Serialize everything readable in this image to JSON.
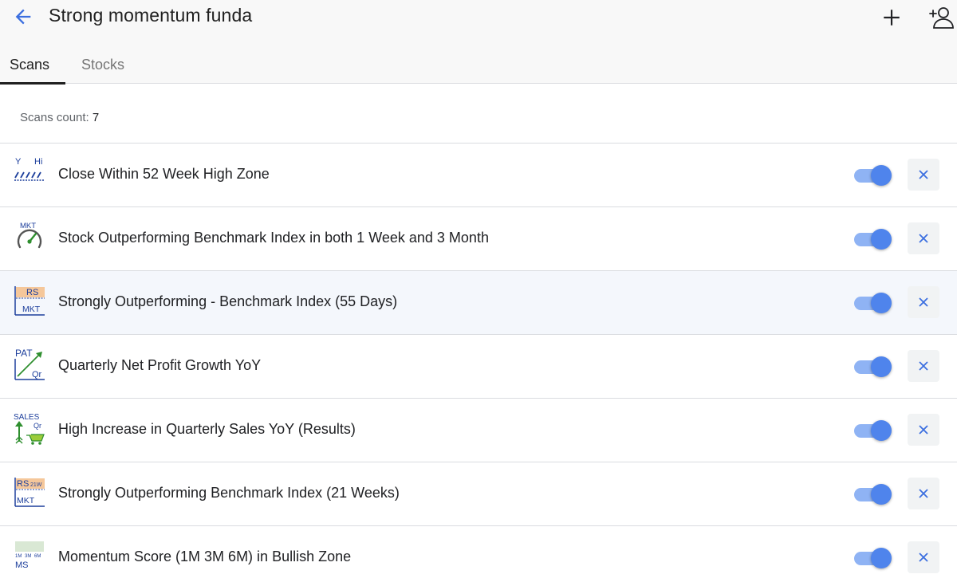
{
  "header": {
    "title": "Strong momentum funda",
    "back_icon": "arrow-left-icon",
    "add_icon": "plus-icon",
    "add_user_icon": "person-add-icon",
    "accent_color": "#3c6fe0"
  },
  "tabs": [
    {
      "label": "Scans",
      "active": true
    },
    {
      "label": "Stocks",
      "active": false
    }
  ],
  "scans_count": {
    "label": "Scans count:",
    "value": "7"
  },
  "scans": [
    {
      "label": "Close Within 52 Week High Zone",
      "icon": "week-high-zone-icon",
      "icon_text": [
        "Y",
        "Hi"
      ],
      "enabled": true
    },
    {
      "label": "Stock Outperforming Benchmark Index in both 1 Week and 3 Month",
      "icon": "market-speedometer-icon",
      "icon_text": [
        "MKT"
      ],
      "enabled": true
    },
    {
      "label": "Strongly Outperforming - Benchmark Index (55 Days)",
      "icon": "relative-strength-icon",
      "icon_text": [
        "RS",
        "MKT"
      ],
      "enabled": true
    },
    {
      "label": "Quarterly Net Profit Growth YoY",
      "icon": "profit-growth-icon",
      "icon_text": [
        "PAT",
        "Qr"
      ],
      "enabled": true
    },
    {
      "label": "High Increase in Quarterly Sales YoY (Results)",
      "icon": "sales-growth-icon",
      "icon_text": [
        "SALES",
        "Qr"
      ],
      "enabled": true
    },
    {
      "label": "Strongly Outperforming Benchmark Index (21 Weeks)",
      "icon": "relative-strength-weekly-icon",
      "icon_text": [
        "RS",
        "21W",
        "MKT"
      ],
      "enabled": true
    },
    {
      "label": "Momentum Score (1M 3M 6M) in Bullish Zone",
      "icon": "momentum-score-icon",
      "icon_text": [
        "1M",
        "3M",
        "6M",
        "MS"
      ],
      "enabled": true
    }
  ],
  "toggle_color": "#4f84ec",
  "highlighted_row": 2
}
